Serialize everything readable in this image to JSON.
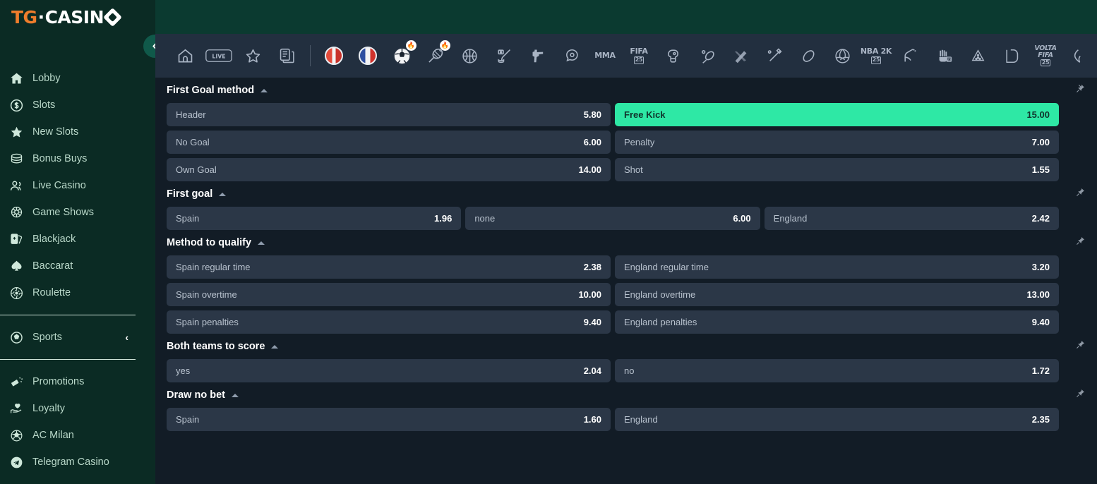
{
  "brand": {
    "logo_tg": "TG",
    "logo_dot": "·",
    "logo_casino": "CASIN",
    "gem_icon": "diamond-icon"
  },
  "sidebar": {
    "collapse_label": "collapse-sidebar",
    "items": [
      {
        "label": "Lobby",
        "icon": "home-icon"
      },
      {
        "label": "Slots",
        "icon": "coin-dollar-icon"
      },
      {
        "label": "New Slots",
        "icon": "star-icon"
      },
      {
        "label": "Bonus Buys",
        "icon": "coins-stack-icon"
      },
      {
        "label": "Live Casino",
        "icon": "people-icon"
      },
      {
        "label": "Game Shows",
        "icon": "wheel-icon"
      },
      {
        "label": "Blackjack",
        "icon": "cards-icon"
      },
      {
        "label": "Baccarat",
        "icon": "spade-icon"
      },
      {
        "label": "Roulette",
        "icon": "roulette-chip-icon"
      }
    ],
    "sports": {
      "label": "Sports",
      "icon": "soccer-ball-icon",
      "chevron": "chevron-left-icon"
    },
    "bottom_items": [
      {
        "label": "Promotions",
        "icon": "megaphone-icon"
      },
      {
        "label": "Loyalty",
        "icon": "hand-heart-icon"
      },
      {
        "label": "AC Milan",
        "icon": "football-icon"
      },
      {
        "label": "Telegram Casino",
        "icon": "telegram-icon"
      }
    ]
  },
  "sportsbar": {
    "items": [
      {
        "icon": "home-icon",
        "type": "svg"
      },
      {
        "icon": "live-icon",
        "type": "svg",
        "text": "LIVE"
      },
      {
        "icon": "star-outline-icon",
        "type": "svg"
      },
      {
        "icon": "bet-slip-icon",
        "type": "svg"
      },
      {
        "icon": "separator",
        "type": "sep"
      },
      {
        "icon": "flag-ball-red-icon",
        "type": "flag"
      },
      {
        "icon": "flag-ball-blue-icon",
        "type": "flag"
      },
      {
        "icon": "soccer-hot-icon",
        "type": "hot",
        "badge": "🔥"
      },
      {
        "icon": "badminton-hot-icon",
        "type": "hot2",
        "badge": "🔥"
      },
      {
        "icon": "basketball-icon",
        "type": "svg"
      },
      {
        "icon": "ice-hockey-icon",
        "type": "svg"
      },
      {
        "icon": "esports-csgo-icon",
        "type": "svg"
      },
      {
        "icon": "dota-icon",
        "type": "svg"
      },
      {
        "icon": "mma-icon",
        "type": "text",
        "text": "MMA"
      },
      {
        "icon": "fifa25-icon",
        "type": "text2",
        "text": "FIFA",
        "sub": "25"
      },
      {
        "icon": "boxing-glove-icon",
        "type": "svg"
      },
      {
        "icon": "table-tennis-icon",
        "type": "svg"
      },
      {
        "icon": "ski-icon",
        "type": "svg"
      },
      {
        "icon": "cricket-icon",
        "type": "svg"
      },
      {
        "icon": "rugby-icon",
        "type": "svg"
      },
      {
        "icon": "volleyball-icon",
        "type": "svg"
      },
      {
        "icon": "nba2k-icon",
        "type": "text2",
        "text": "NBA 2K",
        "sub": "25"
      },
      {
        "icon": "horse-racing-icon",
        "type": "svg"
      },
      {
        "icon": "handball2k-icon",
        "type": "text2",
        "text": "",
        "sub": "25"
      },
      {
        "icon": "billiards-icon",
        "type": "svg"
      },
      {
        "icon": "league-of-legends-icon",
        "type": "svg"
      },
      {
        "icon": "volta-fifa-icon",
        "type": "text3",
        "text": "VOLTA FIFA",
        "sub": "25"
      },
      {
        "icon": "partial-icon",
        "type": "svg"
      }
    ]
  },
  "markets": [
    {
      "title": "First Goal method",
      "columns": 2,
      "pin": "pin-icon",
      "rows": [
        [
          {
            "name": "Header",
            "odds": "5.80",
            "selected": false
          },
          {
            "name": "Free Kick",
            "odds": "15.00",
            "selected": true
          }
        ],
        [
          {
            "name": "No Goal",
            "odds": "6.00",
            "selected": false
          },
          {
            "name": "Penalty",
            "odds": "7.00",
            "selected": false
          }
        ],
        [
          {
            "name": "Own Goal",
            "odds": "14.00",
            "selected": false
          },
          {
            "name": "Shot",
            "odds": "1.55",
            "selected": false
          }
        ]
      ]
    },
    {
      "title": "First goal",
      "columns": 3,
      "pin": "pin-icon",
      "rows": [
        [
          {
            "name": "Spain",
            "odds": "1.96",
            "selected": false
          },
          {
            "name": "none",
            "odds": "6.00",
            "selected": false
          },
          {
            "name": "England",
            "odds": "2.42",
            "selected": false
          }
        ]
      ]
    },
    {
      "title": "Method to qualify",
      "columns": 2,
      "pin": "pin-icon",
      "rows": [
        [
          {
            "name": "Spain regular time",
            "odds": "2.38",
            "selected": false
          },
          {
            "name": "England regular time",
            "odds": "3.20",
            "selected": false
          }
        ],
        [
          {
            "name": "Spain overtime",
            "odds": "10.00",
            "selected": false
          },
          {
            "name": "England overtime",
            "odds": "13.00",
            "selected": false
          }
        ],
        [
          {
            "name": "Spain penalties",
            "odds": "9.40",
            "selected": false
          },
          {
            "name": "England penalties",
            "odds": "9.40",
            "selected": false
          }
        ]
      ]
    },
    {
      "title": "Both teams to score",
      "columns": 2,
      "pin": "pin-icon",
      "rows": [
        [
          {
            "name": "yes",
            "odds": "2.04",
            "selected": false
          },
          {
            "name": "no",
            "odds": "1.72",
            "selected": false
          }
        ]
      ]
    },
    {
      "title": "Draw no bet",
      "columns": 2,
      "pin": "pin-icon",
      "rows": [
        [
          {
            "name": "Spain",
            "odds": "1.60",
            "selected": false
          },
          {
            "name": "England",
            "odds": "2.35",
            "selected": false
          }
        ]
      ]
    }
  ],
  "colors": {
    "sidebar_bg": "#0b2b24",
    "header_green": "#0b3a30",
    "main_bg": "#121c26",
    "sportsbar_bg": "#222f3f",
    "odd_bg": "#2b3747",
    "accent_green": "#2ee8a5",
    "brand_orange": "#ef7d2c",
    "sidebar_text": "#b9d8c9"
  }
}
